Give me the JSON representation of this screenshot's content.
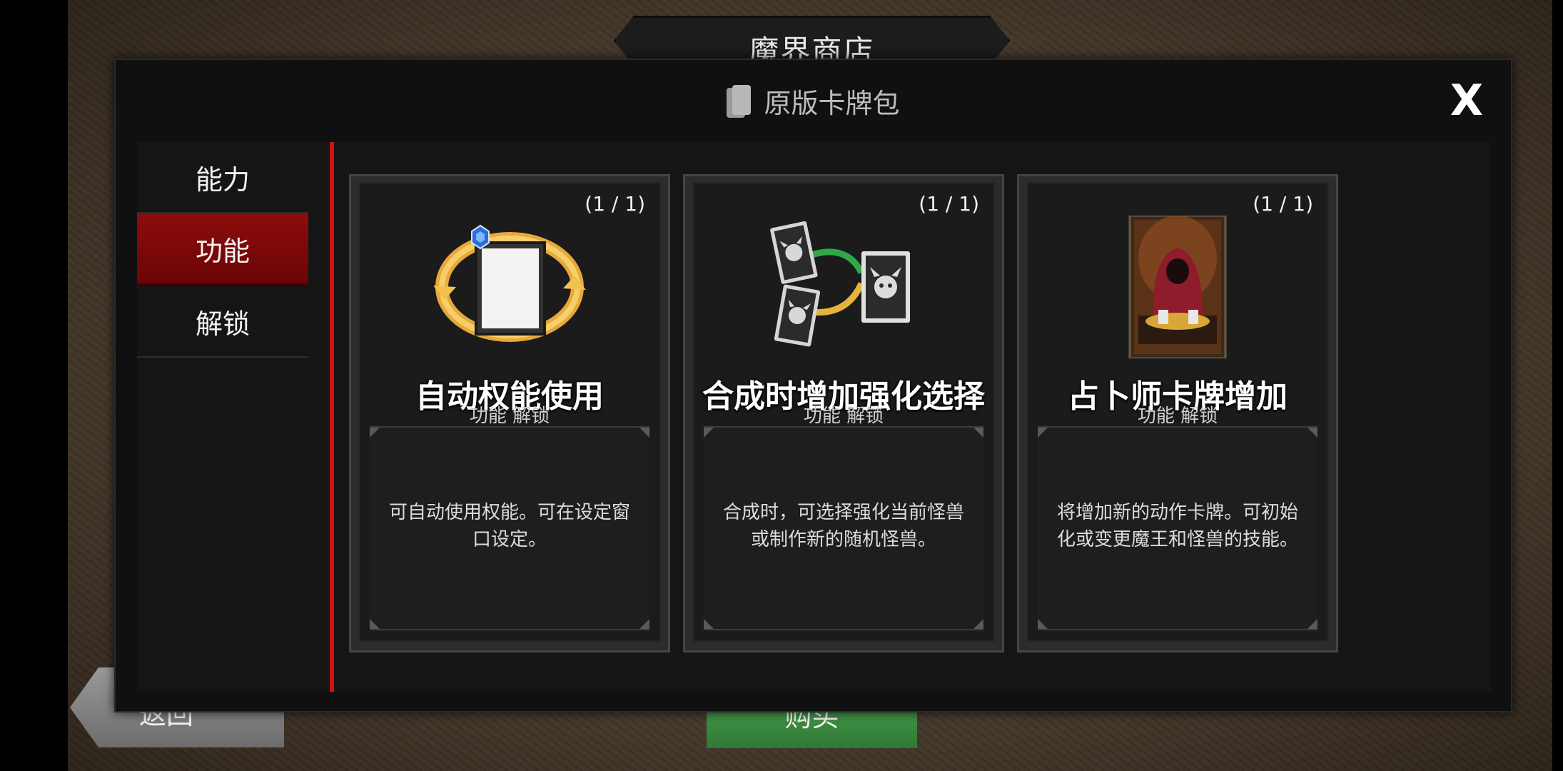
{
  "shop": {
    "title": "魔界商店"
  },
  "bottom": {
    "back_label": "返回",
    "buy_label": "购买"
  },
  "modal": {
    "title": "原版卡牌包",
    "close_label": "X"
  },
  "sidebar": {
    "items": [
      {
        "label": "能力",
        "active": false
      },
      {
        "label": "功能",
        "active": true
      },
      {
        "label": "解锁",
        "active": false
      }
    ]
  },
  "cards": [
    {
      "count": "(1 / 1)",
      "title": "自动权能使用",
      "tag": "功能  解锁",
      "description": "可自动使用权能。可在设定窗口设定。",
      "icon": "auto-cycle-card-icon"
    },
    {
      "count": "(1 / 1)",
      "title": "合成时增加强化选择",
      "tag": "功能  解锁",
      "description": "合成时，可选择强化当前怪兽或制作新的随机怪兽。",
      "icon": "monster-merge-cards-icon"
    },
    {
      "count": "(1 / 1)",
      "title": "占卜师卡牌增加",
      "tag": "功能  解锁",
      "description": "将增加新的动作卡牌。可初始化或变更魔王和怪兽的技能。",
      "icon": "fortune-teller-card-icon"
    }
  ]
}
